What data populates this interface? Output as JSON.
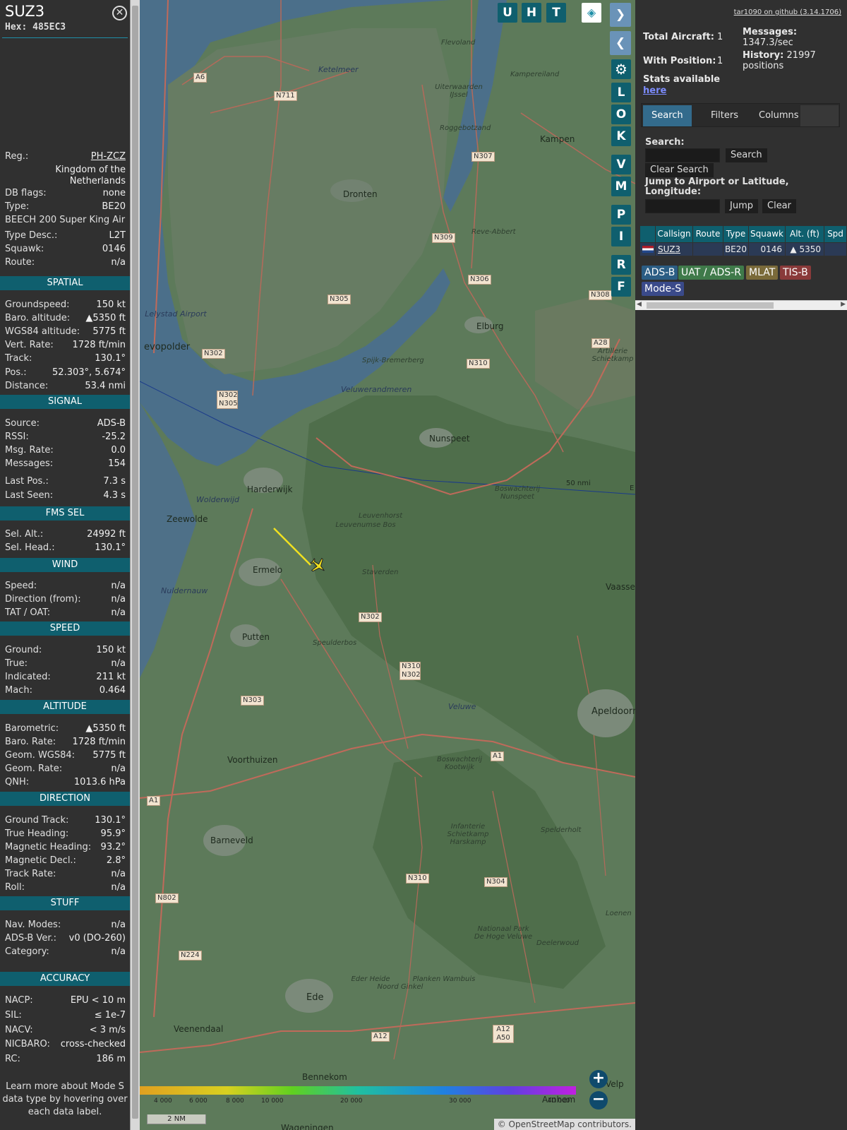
{
  "info": {
    "callsign": "SUZ3",
    "hex_label": "Hex:",
    "hex": "485EC3",
    "rows_top": [
      {
        "k": "Reg.:",
        "v": "PH-ZCZ"
      },
      {
        "k": "",
        "v": "Kingdom of the Netherlands"
      },
      {
        "k": "DB flags:",
        "v": "none"
      },
      {
        "k": "Type:",
        "v": "BE20"
      },
      {
        "k": "BEECH 200 Super King Air",
        "v": ""
      },
      {
        "k": "Type Desc.:",
        "v": "L2T"
      },
      {
        "k": "Squawk:",
        "v": "0146"
      },
      {
        "k": "Route:",
        "v": "n/a"
      }
    ],
    "sections": [
      {
        "title": "SPATIAL",
        "rows": [
          {
            "k": "Groundspeed:",
            "v": "150 kt"
          },
          {
            "k": "Baro. altitude:",
            "v": "▲5350 ft"
          },
          {
            "k": "WGS84 altitude:",
            "v": "5775 ft"
          },
          {
            "k": "Vert. Rate:",
            "v": "1728 ft/min"
          },
          {
            "k": "Track:",
            "v": "130.1°"
          },
          {
            "k": "Pos.:",
            "v": "52.303°, 5.674°"
          },
          {
            "k": "Distance:",
            "v": "53.4 nmi"
          }
        ]
      },
      {
        "title": "SIGNAL",
        "rows": [
          {
            "k": "Source:",
            "v": "ADS-B"
          },
          {
            "k": "RSSI:",
            "v": "-25.2"
          },
          {
            "k": "Msg. Rate:",
            "v": "0.0"
          },
          {
            "k": "Messages:",
            "v": "154"
          },
          {
            "k": "Last Pos.:",
            "v": "7.3 s"
          },
          {
            "k": "Last Seen:",
            "v": "4.3 s"
          }
        ]
      },
      {
        "title": "FMS SEL",
        "rows": [
          {
            "k": "Sel. Alt.:",
            "v": "24992 ft"
          },
          {
            "k": "Sel. Head.:",
            "v": "130.1°"
          }
        ]
      },
      {
        "title": "WIND",
        "rows": [
          {
            "k": "Speed:",
            "v": "n/a"
          },
          {
            "k": "Direction (from):",
            "v": "n/a"
          },
          {
            "k": "TAT / OAT:",
            "v": "n/a"
          }
        ]
      },
      {
        "title": "SPEED",
        "rows": [
          {
            "k": "Ground:",
            "v": "150 kt"
          },
          {
            "k": "True:",
            "v": "n/a"
          },
          {
            "k": "Indicated:",
            "v": "211 kt"
          },
          {
            "k": "Mach:",
            "v": "0.464"
          }
        ]
      },
      {
        "title": "ALTITUDE",
        "rows": [
          {
            "k": "Barometric:",
            "v": "▲5350 ft"
          },
          {
            "k": "Baro. Rate:",
            "v": "1728 ft/min"
          },
          {
            "k": "Geom. WGS84:",
            "v": "5775 ft"
          },
          {
            "k": "Geom. Rate:",
            "v": "n/a"
          },
          {
            "k": "QNH:",
            "v": "1013.6 hPa"
          }
        ]
      },
      {
        "title": "DIRECTION",
        "rows": [
          {
            "k": "Ground Track:",
            "v": "130.1°"
          },
          {
            "k": "True Heading:",
            "v": "95.9°"
          },
          {
            "k": "Magnetic Heading:",
            "v": "93.2°"
          },
          {
            "k": "Magnetic Decl.:",
            "v": "2.8°"
          },
          {
            "k": "Track Rate:",
            "v": "n/a"
          },
          {
            "k": "Roll:",
            "v": "n/a"
          }
        ]
      },
      {
        "title": "STUFF",
        "rows": [
          {
            "k": "Nav. Modes:",
            "v": "n/a"
          },
          {
            "k": "ADS-B Ver.:",
            "v": "v0 (DO-260)"
          },
          {
            "k": "Category:",
            "v": "n/a"
          }
        ]
      },
      {
        "title": "ACCURACY",
        "rows": [
          {
            "k": "NACP:",
            "v": "EPU < 10 m"
          },
          {
            "k": "SIL:",
            "v": "≤ 1e-7"
          },
          {
            "k": "NACV:",
            "v": "< 3 m/s"
          },
          {
            "k": "NICBARO:",
            "v": "cross-checked"
          },
          {
            "k": "RC:",
            "v": "186 m"
          }
        ]
      }
    ],
    "footnote": "Learn more about Mode S data type by hovering over each data label."
  },
  "map": {
    "buttons_top": [
      "U",
      "H",
      "T"
    ],
    "buttons_side": [
      "L",
      "O",
      "K",
      "V",
      "M",
      "P",
      "I",
      "R",
      "F"
    ],
    "places": [
      {
        "name": "Flevoland",
        "cls": "it2"
      },
      {
        "name": "Ketelmeer",
        "cls": "it"
      },
      {
        "name": "Kampereiland",
        "cls": "it2"
      },
      {
        "name": "Uiterwaarden IJssel",
        "cls": "it2"
      },
      {
        "name": "Roggebotzand",
        "cls": "it2"
      },
      {
        "name": "Kampen",
        "cls": ""
      },
      {
        "name": "Dronten",
        "cls": ""
      },
      {
        "name": "Reve-Abbert",
        "cls": "it2"
      },
      {
        "name": "Lelystad Airport",
        "cls": "it"
      },
      {
        "name": "Elburg",
        "cls": ""
      },
      {
        "name": "Artillerie Schietkamp",
        "cls": "it2"
      },
      {
        "name": "Spijk-Bremerberg",
        "cls": "it2"
      },
      {
        "name": "Veluwerandmeren",
        "cls": "it"
      },
      {
        "name": "Nunspeet",
        "cls": ""
      },
      {
        "name": "Harderwijk",
        "cls": ""
      },
      {
        "name": "Zeewolde",
        "cls": ""
      },
      {
        "name": "Wolderwijd",
        "cls": "it"
      },
      {
        "name": "Leuvenhorst",
        "cls": "it2"
      },
      {
        "name": "Leuvenumse Bos",
        "cls": "it2"
      },
      {
        "name": "Boswachterij Nunspeet",
        "cls": "it2"
      },
      {
        "name": "Ermelo",
        "cls": ""
      },
      {
        "name": "Staverden",
        "cls": "it2"
      },
      {
        "name": "Nuldernauw",
        "cls": "it"
      },
      {
        "name": "Vaassen",
        "cls": ""
      },
      {
        "name": "Putten",
        "cls": ""
      },
      {
        "name": "Speulderbos",
        "cls": "it2"
      },
      {
        "name": "Veluwe",
        "cls": "it"
      },
      {
        "name": "Apeldoorn",
        "cls": "big"
      },
      {
        "name": "Voorthuizen",
        "cls": ""
      },
      {
        "name": "Boswachterij Kootwijk",
        "cls": "it2"
      },
      {
        "name": "Barneveld",
        "cls": ""
      },
      {
        "name": "Infanterie Schietkamp Harskamp",
        "cls": "it2"
      },
      {
        "name": "Spelderholt",
        "cls": "it2"
      },
      {
        "name": "Loenen",
        "cls": "it2"
      },
      {
        "name": "Nationaal Park De Hoge Veluwe",
        "cls": "it2"
      },
      {
        "name": "Deelerwoud",
        "cls": "it2"
      },
      {
        "name": "Eder Heide",
        "cls": "it2"
      },
      {
        "name": "Noord Ginkel",
        "cls": "it2"
      },
      {
        "name": "Planken Wambuis",
        "cls": "it2"
      },
      {
        "name": "Ede",
        "cls": "big"
      },
      {
        "name": "Veenendaal",
        "cls": ""
      },
      {
        "name": "Bennekom",
        "cls": ""
      },
      {
        "name": "Arnhem",
        "cls": ""
      },
      {
        "name": "Velp",
        "cls": ""
      },
      {
        "name": "evopolder",
        "cls": "big"
      },
      {
        "name": "Wageningen",
        "cls": ""
      }
    ],
    "roads": [
      "A6",
      "N711",
      "N307",
      "N309",
      "N306",
      "N305",
      "N308",
      "A28",
      "N302",
      "N302 N305",
      "N310",
      "N302",
      "N310 N302",
      "N303",
      "A1",
      "A1",
      "N304",
      "N310",
      "N802",
      "N224",
      "A12 A50",
      "A12"
    ],
    "range_label": "50 nmi",
    "range_label_e": "E",
    "colorbar_ticks": [
      "4 000",
      "6 000",
      "8 000",
      "10 000",
      "20 000",
      "30 000",
      "40 000"
    ],
    "scale": "2 NM",
    "attribution": "© OpenStreetMap contributors.",
    "zoom_in": "+",
    "zoom_out": "−"
  },
  "sidebar": {
    "github": "tar1090 on github (3.14.1706)",
    "total_aircraft_label": "Total Aircraft:",
    "total_aircraft": "1",
    "with_position_label": "With Position:",
    "with_position": "1",
    "messages_label": "Messages:",
    "messages": "1347.3/sec",
    "history_label": "History:",
    "history": "21997 positions",
    "stats_label": "Stats available",
    "stats_link": "here",
    "tabs": [
      "Search",
      "Filters",
      "Columns"
    ],
    "search_label": "Search:",
    "search_btn": "Search",
    "clear_search_btn": "Clear Search",
    "jump_label": "Jump to Airport or Latitude, Longitude:",
    "jump_btn": "Jump",
    "clear_btn": "Clear",
    "columns": [
      "Callsign",
      "Route",
      "Type",
      "Squawk",
      "Alt. (ft)",
      "Spd"
    ],
    "rows": [
      {
        "callsign": "SUZ3",
        "route": "",
        "type": "BE20",
        "squawk": "0146",
        "alt": "▲ 5350",
        "spd": ""
      }
    ],
    "badges": [
      {
        "label": "ADS-B",
        "color": "#2b5d84"
      },
      {
        "label": "UAT / ADS-R",
        "color": "#3f7a4a"
      },
      {
        "label": "MLAT",
        "color": "#7a6a3a"
      },
      {
        "label": "TIS-B",
        "color": "#8a3a3a"
      },
      {
        "label": "Mode-S",
        "color": "#3a4a8a"
      }
    ]
  }
}
